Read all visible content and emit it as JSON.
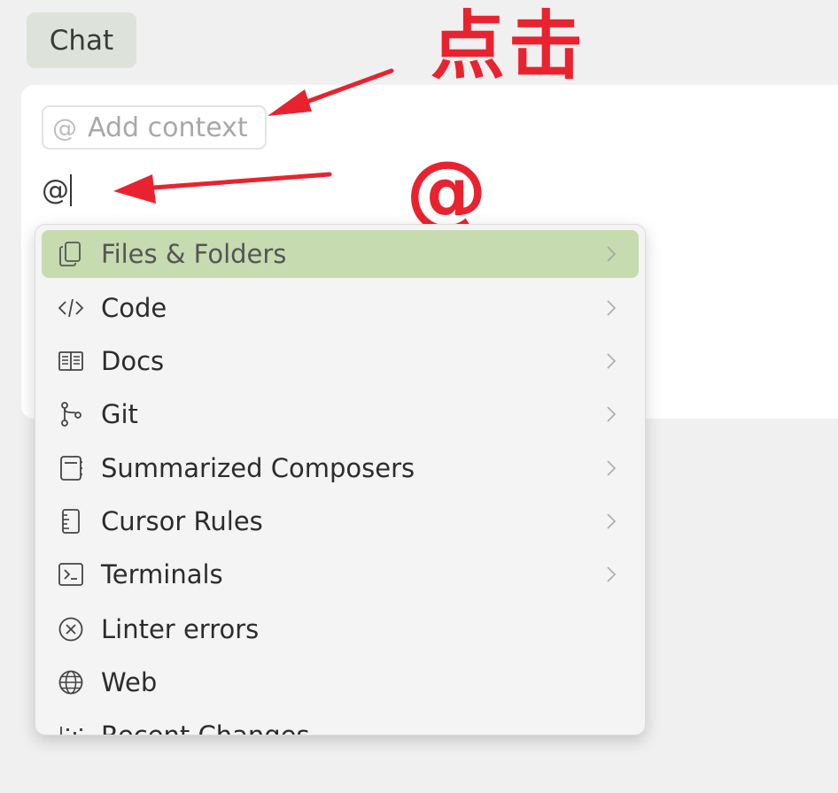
{
  "header": {
    "tab_label": "Chat"
  },
  "composer": {
    "context_icon": "@",
    "context_label": "Add context",
    "input_value": "@"
  },
  "annotations": {
    "click_text": "点击",
    "at_text": "@",
    "color": "#e8232f"
  },
  "menu": {
    "selected_color": "#c6dbb0",
    "items": [
      {
        "label": "Files & Folders",
        "icon": "files-icon",
        "has_submenu": true,
        "selected": true
      },
      {
        "label": "Code",
        "icon": "code-icon",
        "has_submenu": true
      },
      {
        "label": "Docs",
        "icon": "book-icon",
        "has_submenu": true
      },
      {
        "label": "Git",
        "icon": "git-branch-icon",
        "has_submenu": true
      },
      {
        "label": "Summarized Composers",
        "icon": "notebook-icon",
        "has_submenu": true
      },
      {
        "label": "Cursor Rules",
        "icon": "ruler-doc-icon",
        "has_submenu": true
      },
      {
        "label": "Terminals",
        "icon": "terminal-icon",
        "has_submenu": true
      },
      {
        "label": "Linter errors",
        "icon": "error-circle-icon",
        "has_submenu": false
      },
      {
        "label": "Web",
        "icon": "globe-icon",
        "has_submenu": false
      },
      {
        "label": "Recent Changes",
        "icon": "recent-changes-icon",
        "has_submenu": false
      }
    ]
  }
}
